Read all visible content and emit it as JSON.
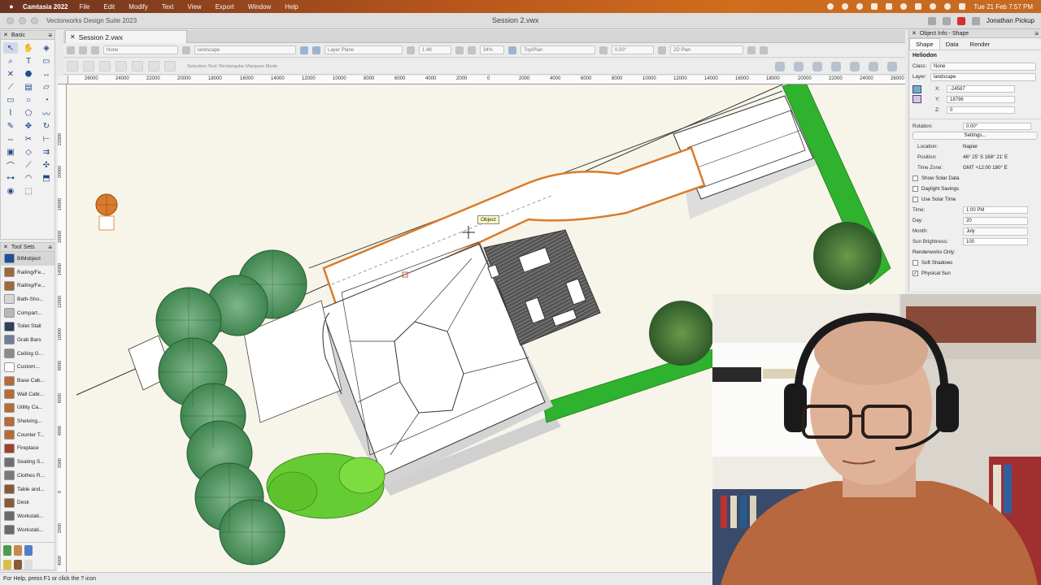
{
  "menubar": {
    "app": "Camtasia 2022",
    "items": [
      "File",
      "Edit",
      "Modify",
      "Text",
      "View",
      "Export",
      "Window",
      "Help"
    ],
    "clock": "Tue 21 Feb 7:57 PM"
  },
  "window": {
    "app_title": "Vectorworks Design Suite 2023",
    "doc_title": "Session 2.vwx",
    "user": "Jonathan Pickup"
  },
  "basic_palette": {
    "title": "Basic"
  },
  "toolsets": {
    "title": "Tool Sets",
    "items": [
      {
        "label": "BIMobject",
        "color": "#1d4f9c"
      },
      {
        "label": "Railing/Fe...",
        "color": "#9d6b3a"
      },
      {
        "label": "Railing/Fe...",
        "color": "#9d6b3a"
      },
      {
        "label": "Bath-Sho...",
        "color": "#d7d7d7"
      },
      {
        "label": "Compart...",
        "color": "#b7b7b7"
      },
      {
        "label": "Toilet Stall",
        "color": "#2f3f5a"
      },
      {
        "label": "Grab Bars",
        "color": "#6f7f9a"
      },
      {
        "label": "Ceiling G...",
        "color": "#8c8c8c"
      },
      {
        "label": "Custom...",
        "color": "#ffffff"
      },
      {
        "label": "Base Cab...",
        "color": "#b86b34"
      },
      {
        "label": "Wall Cabi...",
        "color": "#b86b34"
      },
      {
        "label": "Utility Ca...",
        "color": "#b86b34"
      },
      {
        "label": "Shelving...",
        "color": "#b86b34"
      },
      {
        "label": "Counter T...",
        "color": "#b86b34"
      },
      {
        "label": "Fireplace",
        "color": "#a0432a"
      },
      {
        "label": "Seating S...",
        "color": "#707070"
      },
      {
        "label": "Clothes R...",
        "color": "#7a7a7a"
      },
      {
        "label": "Table and...",
        "color": "#8a5a34"
      },
      {
        "label": "Desk",
        "color": "#8a5a34"
      },
      {
        "label": "Workstati...",
        "color": "#6a6a6a"
      },
      {
        "label": "Workstati...",
        "color": "#6a6a6a"
      }
    ]
  },
  "tab": {
    "label": "Session 2.vwx"
  },
  "viewbar": {
    "class": "None",
    "layer": "landscape",
    "plane": "Layer Plane",
    "scale": "1:48",
    "zoom": "34%",
    "view": "Top/Plan",
    "rotation": "0.00°",
    "render": "2D Plan"
  },
  "modebar": {
    "hint": "Selection Tool: Rectangular Marquee Mode"
  },
  "ruler": {
    "h_ticks": [
      "26000",
      "24000",
      "22000",
      "20000",
      "18000",
      "16000",
      "14000",
      "12000",
      "10000",
      "8000",
      "6000",
      "4000",
      "2000",
      "0",
      "2000",
      "4000",
      "6000",
      "8000",
      "10000",
      "12000",
      "14000",
      "16000",
      "18000",
      "20000",
      "22000",
      "24000",
      "26000"
    ],
    "v_ticks": [
      "22000",
      "20000",
      "18000",
      "16000",
      "14000",
      "12000",
      "10000",
      "8000",
      "6000",
      "4000",
      "2000",
      "0",
      "2000",
      "4000",
      "6000"
    ]
  },
  "canvas": {
    "tooltip": "Object"
  },
  "object_info": {
    "title": "Object Info - Shape",
    "tabs": [
      "Shape",
      "Data",
      "Render"
    ],
    "object": "Heliodon",
    "class_label": "Class:",
    "class_value": "None",
    "layer_label": "Layer:",
    "layer_value": "landscape",
    "x_label": "X:",
    "x_value": "-24587",
    "y_label": "Y:",
    "y_value": "18796",
    "z_label": "Z:",
    "z_value": "0",
    "rotation_label": "Rotation:",
    "rotation_value": "0.00°",
    "settings_label": "Settings...",
    "location_label": "Location:",
    "location_value": "Napier",
    "position_label": "Position:",
    "position_value": "46° 25' S 168° 21' E",
    "timezone_label": "Time Zone:",
    "timezone_value": "GMT +12:00 180° E",
    "show_solar_label": "Show Solar Data",
    "daylight_label": "Daylight Savings",
    "use_solar_label": "Use Solar Time",
    "time_label": "Time:",
    "time_value": "1:00 PM",
    "day_label": "Day:",
    "day_value": "20",
    "month_label": "Month:",
    "month_value": "July",
    "brightness_label": "Sun Brightness:",
    "brightness_value": "100",
    "renderworks_label": "Renderworks Only:",
    "soft_shadows_label": "Soft Shadows",
    "physical_sun_label": "Physical Sun"
  },
  "status": {
    "text": "For Help, press F1 or click the ? icon"
  },
  "colors": {
    "accent_orange": "#d97b2b",
    "lawn_green": "#2fb22d",
    "canvas_bg": "#f7f5e9",
    "menubar_orange": "#c9631d"
  }
}
